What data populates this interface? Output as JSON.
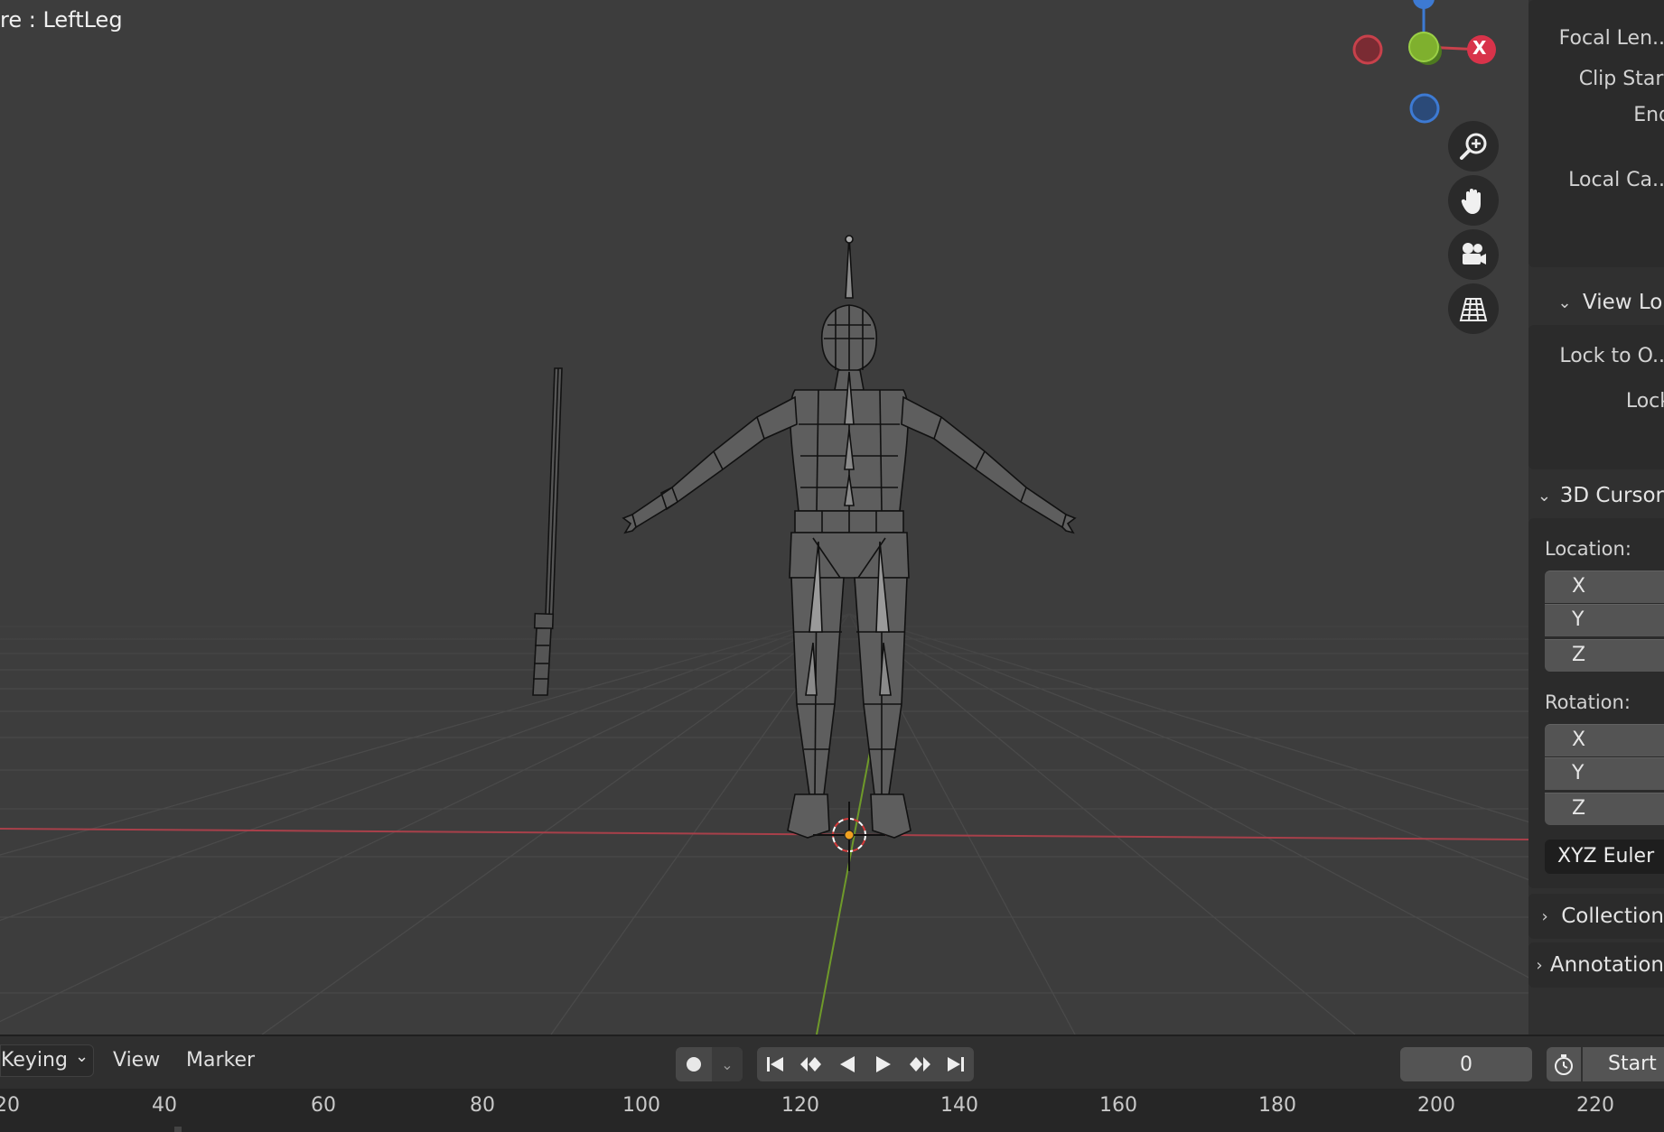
{
  "viewport": {
    "title": "re : LeftLeg",
    "gizmo": {
      "x_label": "X"
    },
    "nav_icons": [
      "zoom-icon",
      "hand-pan-icon",
      "camera-icon",
      "grid-view-icon"
    ]
  },
  "npanel": {
    "view": {
      "focal_length_label": "Focal Len...",
      "clip_start_label": "Clip Start",
      "clip_end_label": "End",
      "local_camera_label": "Local Ca..."
    },
    "view_lock": {
      "title": "View Lo",
      "lock_to_object_label": "Lock to O...",
      "lock_label": "Lock"
    },
    "cursor": {
      "title": "3D Cursor",
      "location_label": "Location:",
      "location_axes": [
        "X",
        "Y",
        "Z"
      ],
      "rotation_label": "Rotation:",
      "rotation_axes": [
        "X",
        "Y",
        "Z"
      ],
      "rotation_mode": "XYZ Euler"
    },
    "collection": {
      "title": "Collection"
    },
    "annotations": {
      "title": "Annotation"
    }
  },
  "timeline": {
    "menus": [
      "Keying",
      "View",
      "Marker"
    ],
    "current_frame": "0",
    "start_label": "Start",
    "ruler_ticks": [
      "20",
      "40",
      "60",
      "80",
      "100",
      "120",
      "140",
      "160",
      "180",
      "200",
      "220"
    ]
  },
  "colors": {
    "background": "#3d3d3d",
    "x_axis": "#c8414b",
    "y_axis": "#6f9a2a",
    "z_axis": "#3d7ad3",
    "panel": "#303030"
  }
}
